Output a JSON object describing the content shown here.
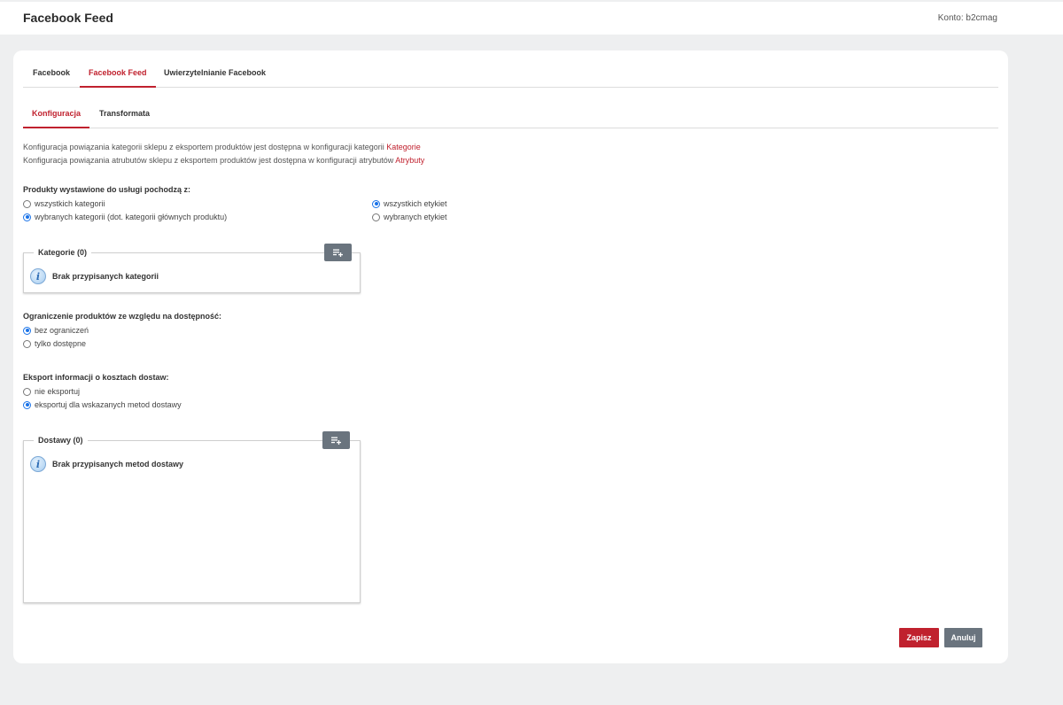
{
  "header": {
    "title": "Facebook Feed",
    "account_label": "Konto:",
    "account_value": "b2cmag"
  },
  "main_tabs": [
    {
      "label": "Facebook",
      "active": false
    },
    {
      "label": "Facebook Feed",
      "active": true
    },
    {
      "label": "Uwierzytelnianie Facebook",
      "active": false
    }
  ],
  "sub_tabs": [
    {
      "label": "Konfiguracja",
      "active": true
    },
    {
      "label": "Transformata",
      "active": false
    }
  ],
  "info": {
    "line1_text": "Konfiguracja powiązania kategorii sklepu z eksportem produktów jest dostępna w konfiguracji kategorii",
    "line1_link": "Kategorie",
    "line2_text": "Konfiguracja powiązania atrubutów sklepu z eksportem produktów jest dostępna w konfiguracji atrybutów",
    "line2_link": "Atrybuty"
  },
  "products_source": {
    "label": "Produkty wystawione do usługi pochodzą z:",
    "categories": [
      {
        "label": "wszystkich kategorii",
        "checked": false
      },
      {
        "label": "wybranych kategorii (dot. kategorii głównych produktu)",
        "checked": true
      }
    ],
    "labels": [
      {
        "label": "wszystkich etykiet",
        "checked": true
      },
      {
        "label": "wybranych etykiet",
        "checked": false
      }
    ]
  },
  "categories_box": {
    "legend": "Kategorie (0)",
    "empty_message": "Brak przypisanych kategorii",
    "add_icon": "add-list-icon"
  },
  "availability": {
    "label": "Ograniczenie produktów ze względu na dostępność:",
    "options": [
      {
        "label": "bez ograniczeń",
        "checked": true
      },
      {
        "label": "tylko dostępne",
        "checked": false
      }
    ]
  },
  "shipping_export": {
    "label": "Eksport informacji o kosztach dostaw:",
    "options": [
      {
        "label": "nie eksportuj",
        "checked": false
      },
      {
        "label": "eksportuj dla wskazanych metod dostawy",
        "checked": true
      }
    ]
  },
  "delivery_box": {
    "legend": "Dostawy (0)",
    "empty_message": "Brak przypisanych metod dostawy",
    "add_icon": "add-list-icon"
  },
  "actions": {
    "save": "Zapisz",
    "cancel": "Anuluj"
  },
  "colors": {
    "accent": "#c0212e",
    "secondary_button": "#6a747e",
    "radio_checked": "#1a73e8",
    "background": "#eeeff0"
  }
}
